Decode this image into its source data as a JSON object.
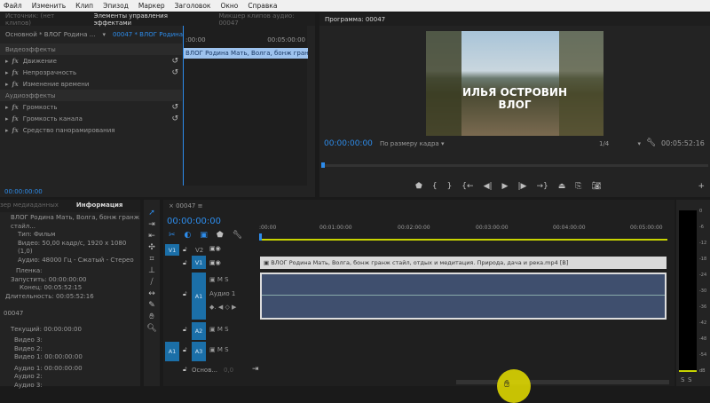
{
  "menu": [
    "Файл",
    "Изменить",
    "Клип",
    "Эпизод",
    "Маркер",
    "Заголовок",
    "Окно",
    "Справка"
  ],
  "effects_panel": {
    "tabs": [
      "Источник: (нет клипов)",
      "Элементы управления эффектами",
      "Микшер клипов аудио: 00047"
    ],
    "source_select": "Основной * ВЛОГ Родина ...",
    "sequence_select": "00047 * ВЛОГ Родина ...",
    "time_start": ":00:00",
    "time_end": "00:05:00:00",
    "clip_bar": "ВЛОГ Родина Мать, Волга, бонж гранж стай",
    "video_header": "Видеоэффекты",
    "video_effects": [
      "Движение",
      "Непрозрачность",
      "Изменение времени"
    ],
    "audio_header": "Аудиоэффекты",
    "audio_effects": [
      "Громкость",
      "Громкость канала",
      "Средство панорамирования"
    ],
    "timecode": "00:00:00:00"
  },
  "program": {
    "title": "Программа: 00047",
    "overlay_line1": "ИЛЬЯ ОСТРОВИН",
    "overlay_line2": "ВЛОГ",
    "timecode": "00:00:00:00",
    "fit": "По размеру кадра",
    "resolution": "1/4",
    "duration": "00:05:52:16"
  },
  "info_panel": {
    "tabs": [
      "зер медиаданных",
      "Информация"
    ],
    "clip_name": "ВЛОГ Родина Мать, Волга, бонж гранж стайл...",
    "lines": [
      [
        "Тип:",
        "Фильм"
      ],
      [
        "Видео:",
        "50,00 кадр/с, 1920 x 1080 (1,0)"
      ],
      [
        "Аудио:",
        "48000 Гц - Сжатый - Стерео"
      ]
    ],
    "tape_label": "Пленка:",
    "times": [
      [
        "Запустить:",
        "00:00:00:00"
      ],
      [
        "Конец:",
        "00:05:52:15"
      ],
      [
        "Длительность:",
        "00:05:52:16"
      ]
    ],
    "sequence": "00047",
    "current": [
      "Текущий:",
      "00:00:00:00"
    ],
    "tracks": [
      [
        "Видео 3:",
        ""
      ],
      [
        "Видео 2:",
        ""
      ],
      [
        "Видео 1:",
        "00:00:00:00"
      ],
      [
        "Аудио 1:",
        "00:00:00:00"
      ],
      [
        "Аудио 2:",
        ""
      ],
      [
        "Аудио 3:",
        ""
      ]
    ]
  },
  "timeline": {
    "tab": "00047",
    "timecode": "00:00:00:00",
    "ruler": [
      ":00:00",
      "00:01:00:00",
      "00:02:00:00",
      "00:03:00:00",
      "00:04:00:00",
      "00:05:00:00"
    ],
    "video_clip": "ВЛОГ Родина Мать, Волга, бонж гранж стайл, отдых и медитация. Природа, дача и река.mp4 [В]",
    "tracks": {
      "v2": "V2",
      "v1": "V1",
      "a1": "A1",
      "a2": "A2",
      "a3": "A3",
      "src_v": "V1",
      "src_a": "A1",
      "audio1_name": "Аудио 1",
      "m": "M",
      "s": "S",
      "master": "Основ...",
      "master_val": "0,0"
    }
  },
  "meter": {
    "scale": [
      "0",
      "-6",
      "-12",
      "-18",
      "-24",
      "-30",
      "-36",
      "-42",
      "-48",
      "-54",
      "dB"
    ],
    "solo": [
      "S",
      "S"
    ]
  },
  "colors": {
    "accent": "#2d8ceb",
    "track_blue": "#1b6fa8",
    "audio_clip": "#3f4f6e",
    "work_bar": "#c8d400",
    "cursor": "#e8e000"
  }
}
